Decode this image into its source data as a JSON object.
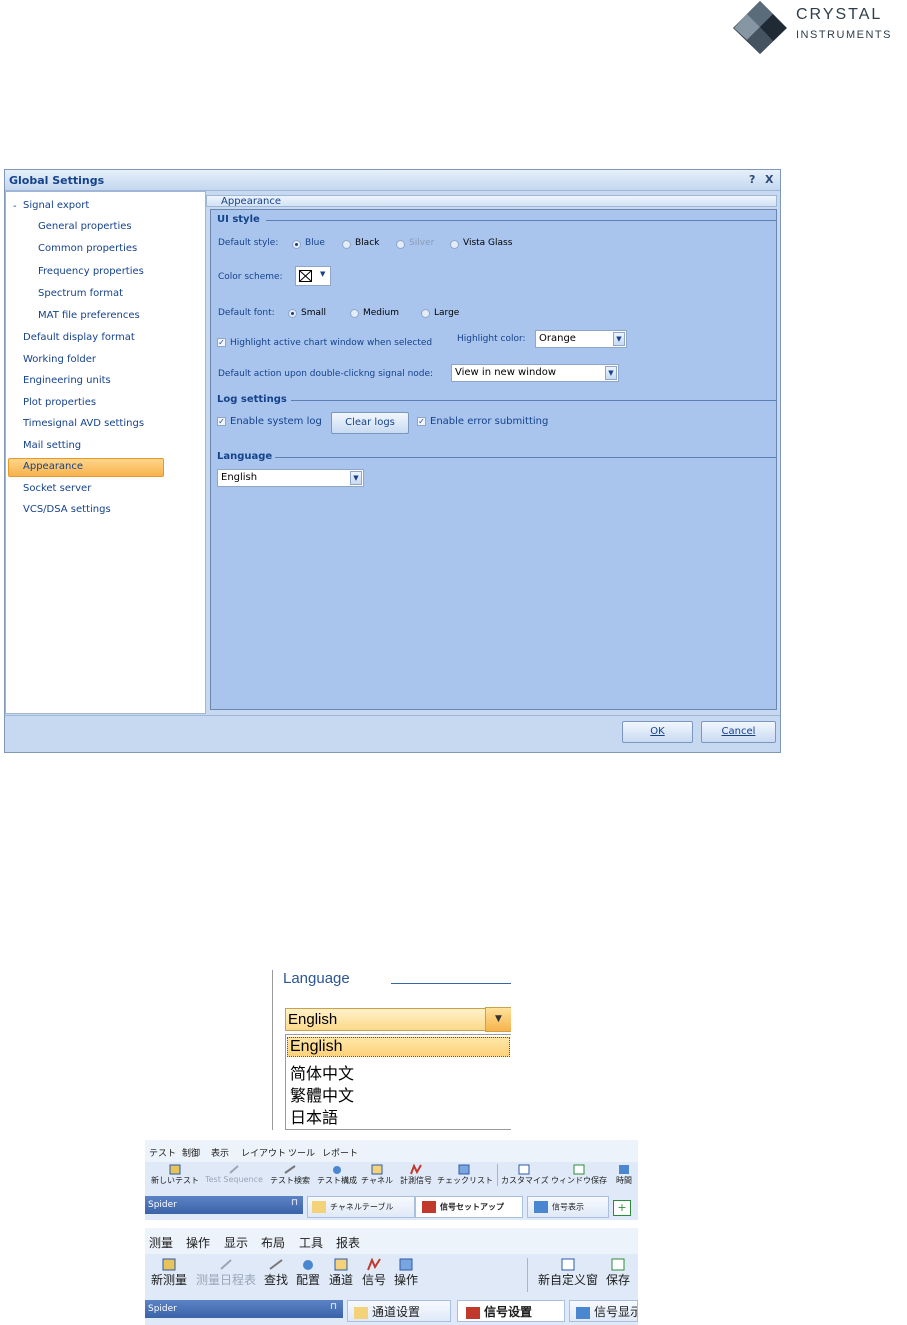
{
  "logo": {
    "line1": "CRYSTAL",
    "line2": "INSTRUMENTS"
  },
  "dialog": {
    "title": "Global Settings",
    "help_glyph": "?",
    "close_glyph": "X",
    "nav": {
      "collapse_glyph": "-",
      "items": [
        "Signal export",
        "General properties",
        "Common properties",
        "Frequency properties",
        "Spectrum format",
        "MAT file preferences",
        "Default display format",
        "Working folder",
        "Engineering units",
        "Plot properties",
        "Timesignal AVD settings",
        "Mail setting",
        "Appearance",
        "Socket server",
        "VCS/DSA settings"
      ],
      "selected": "Appearance"
    },
    "panel_title": "Appearance",
    "ui_style": {
      "header": "UI style",
      "default_style_label": "Default style:",
      "style_options": [
        "Blue",
        "Black",
        "Silver",
        "Vista Glass"
      ],
      "style_selected": "Blue",
      "color_scheme_label": "Color scheme:",
      "default_font_label": "Default font:",
      "font_options": [
        "Small",
        "Medium",
        "Large"
      ],
      "font_selected": "Small",
      "highlight_checkbox_label": "Highlight active chart window when selected",
      "highlight_checked": true,
      "highlight_color_label": "Highlight color:",
      "highlight_color_value": "Orange",
      "double_click_label": "Default action upon double-clickng signal node:",
      "double_click_value": "View in new window"
    },
    "log_settings": {
      "header": "Log settings",
      "enable_system_log_label": "Enable system log",
      "enable_system_log_checked": true,
      "clear_logs_label": "Clear logs",
      "enable_error_submitting_label": "Enable error submitting",
      "enable_error_submitting_checked": true
    },
    "language": {
      "header": "Language",
      "value": "English"
    },
    "ok_label": "OK",
    "cancel_label": "Cancel"
  },
  "language_dropdown": {
    "title": "Language",
    "value": "English",
    "options": [
      "English",
      "简体中文",
      "繁體中文",
      "日本語"
    ],
    "highlighted": "English"
  },
  "toolbar_japanese": {
    "menu": [
      "テスト",
      "制御",
      "表示",
      "レイアウト",
      "ツール",
      "レポート"
    ],
    "tools": [
      "新しいテスト",
      "Test Sequence",
      "テスト検索",
      "テスト構成",
      "チャネル",
      "計測信号",
      "チェックリスト",
      "カスタマイズ",
      "ウィンドウ保存",
      "時間"
    ],
    "panel": "Spider",
    "tabs": [
      "チャネルテーブル",
      "信号セットアップ",
      "信号表示"
    ]
  },
  "toolbar_chinese": {
    "menu": [
      "测量",
      "操作",
      "显示",
      "布局",
      "工具",
      "报表"
    ],
    "tools": [
      "新测量",
      "测量日程表",
      "查找",
      "配置",
      "通道",
      "信号",
      "操作",
      "新自定义窗",
      "保存"
    ],
    "panel": "Spider",
    "tabs": [
      "通道设置",
      "信号设置",
      "信号显示"
    ]
  },
  "colors": {
    "dialog_bg": "#c6d9f1",
    "panel_bg": "#a9c5ee",
    "selection": "#f7b24c",
    "text_blue": "#15428b"
  },
  "icons": [
    "crystal-diamond-logo-icon",
    "color-scheme-icon",
    "chevron-down-icon",
    "toolbar-tool-icon",
    "tab-icon",
    "pin-icon",
    "add-tab-icon"
  ]
}
